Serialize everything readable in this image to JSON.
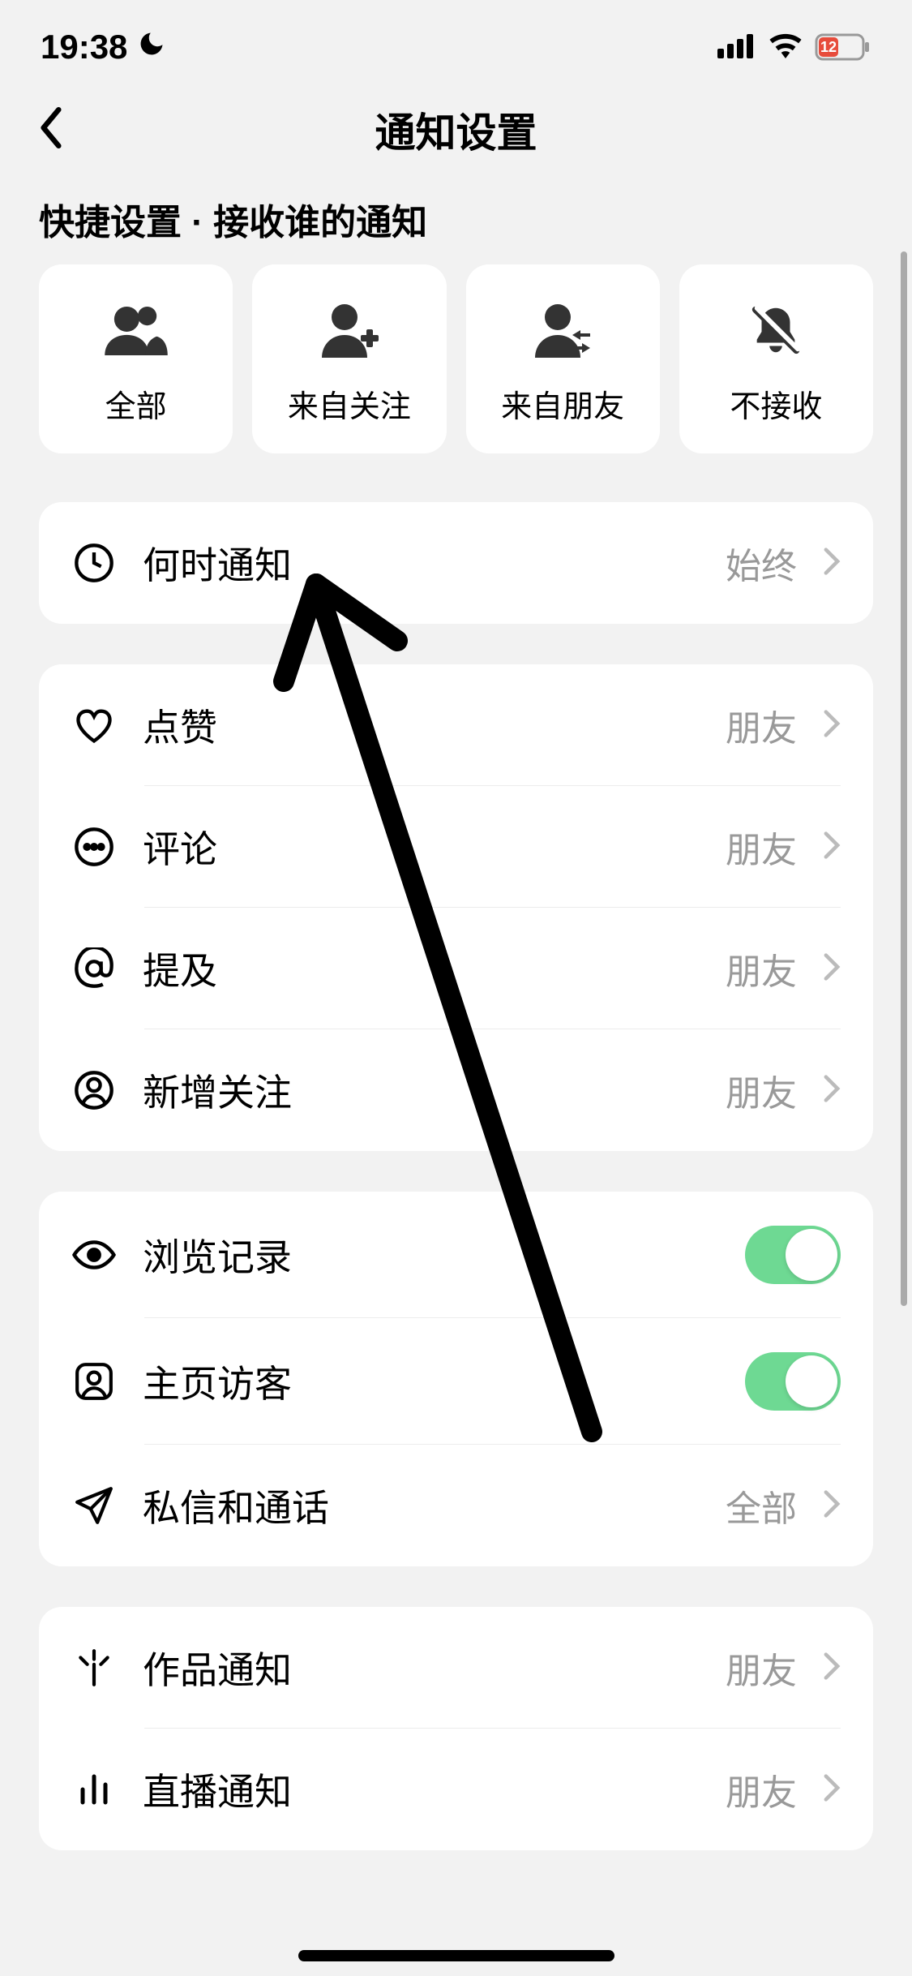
{
  "status": {
    "time": "19:38",
    "battery": "12"
  },
  "header": {
    "title": "通知设置"
  },
  "section_title": "快捷设置 · 接收谁的通知",
  "quick": [
    {
      "label": "全部",
      "icon": "people-icon"
    },
    {
      "label": "来自关注",
      "icon": "person-plus-icon"
    },
    {
      "label": "来自朋友",
      "icon": "person-exchange-icon"
    },
    {
      "label": "不接收",
      "icon": "bell-mute-icon"
    }
  ],
  "group1": [
    {
      "label": "何时通知",
      "value": "始终",
      "icon": "clock-icon"
    }
  ],
  "group2": [
    {
      "label": "点赞",
      "value": "朋友",
      "icon": "heart-icon"
    },
    {
      "label": "评论",
      "value": "朋友",
      "icon": "comment-icon"
    },
    {
      "label": "提及",
      "value": "朋友",
      "icon": "at-icon"
    },
    {
      "label": "新增关注",
      "value": "朋友",
      "icon": "person-circle-icon"
    }
  ],
  "group3": [
    {
      "label": "浏览记录",
      "toggle": true,
      "icon": "eye-icon"
    },
    {
      "label": "主页访客",
      "toggle": true,
      "icon": "person-square-icon"
    },
    {
      "label": "私信和通话",
      "value": "全部",
      "icon": "send-icon"
    }
  ],
  "group4": [
    {
      "label": "作品通知",
      "value": "朋友",
      "icon": "sparkle-icon"
    },
    {
      "label": "直播通知",
      "value": "朋友",
      "icon": "bars-icon"
    }
  ]
}
